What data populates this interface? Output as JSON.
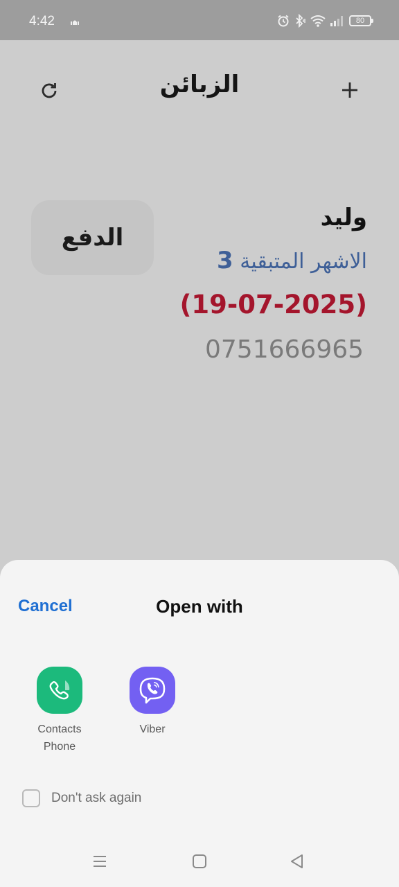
{
  "status_bar": {
    "time": "4:42",
    "battery": "80",
    "icons": [
      "mosque-icon",
      "alarm-icon",
      "bluetooth-icon",
      "wifi-icon",
      "signal-icon",
      "battery-icon"
    ]
  },
  "header": {
    "title": "الزبائن",
    "refresh_icon": "refresh-icon",
    "add_icon": "plus-icon"
  },
  "customer": {
    "name": "وليد",
    "months_label": "الاشهر المتبقية",
    "months_value": "3",
    "due_date": "(19-07-2025)",
    "phone": "0751666965",
    "pay_label": "الدفع"
  },
  "sheet": {
    "cancel_label": "Cancel",
    "title": "Open with",
    "apps": [
      {
        "label": "Contacts\nPhone",
        "label_line1": "Contacts",
        "label_line2": "Phone",
        "icon": "phone-icon",
        "color": "#1cba7c"
      },
      {
        "label": "Viber",
        "icon": "viber-icon",
        "color": "#7360f2"
      }
    ],
    "dont_ask_label": "Don't ask again",
    "dont_ask_checked": false
  },
  "nav_bar": {
    "icons": [
      "menu-icon",
      "home-icon",
      "back-icon"
    ]
  },
  "colors": {
    "accent_blue": "#1f6fd2",
    "months_blue": "#3e5f97",
    "date_red": "#a4152c",
    "contacts_green": "#1cba7c",
    "viber_purple": "#7360f2"
  }
}
